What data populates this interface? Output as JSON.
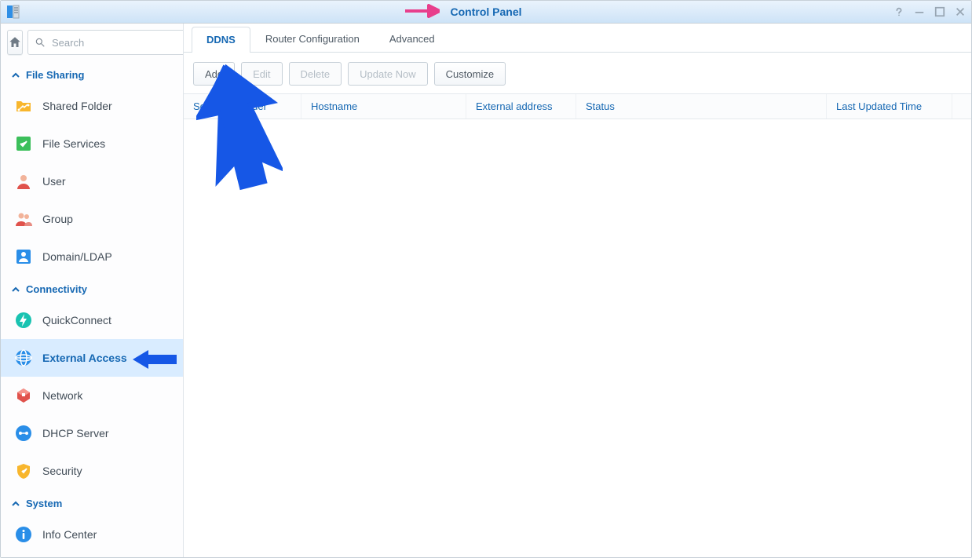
{
  "window": {
    "title": "Control Panel"
  },
  "search": {
    "placeholder": "Search"
  },
  "sections": {
    "file_sharing": "File Sharing",
    "connectivity": "Connectivity",
    "system": "System"
  },
  "sidebar": {
    "shared_folder": "Shared Folder",
    "file_services": "File Services",
    "user": "User",
    "group": "Group",
    "domain_ldap": "Domain/LDAP",
    "quickconnect": "QuickConnect",
    "external_access": "External Access",
    "network": "Network",
    "dhcp_server": "DHCP Server",
    "security": "Security",
    "info_center": "Info Center"
  },
  "tabs": {
    "ddns": "DDNS",
    "router": "Router Configuration",
    "advanced": "Advanced"
  },
  "toolbar": {
    "add": "Add",
    "edit": "Edit",
    "delete": "Delete",
    "update": "Update Now",
    "customize": "Customize"
  },
  "columns": {
    "service_provider": "Service provider",
    "hostname": "Hostname",
    "external_address": "External address",
    "status": "Status",
    "last_updated": "Last Updated Time"
  }
}
